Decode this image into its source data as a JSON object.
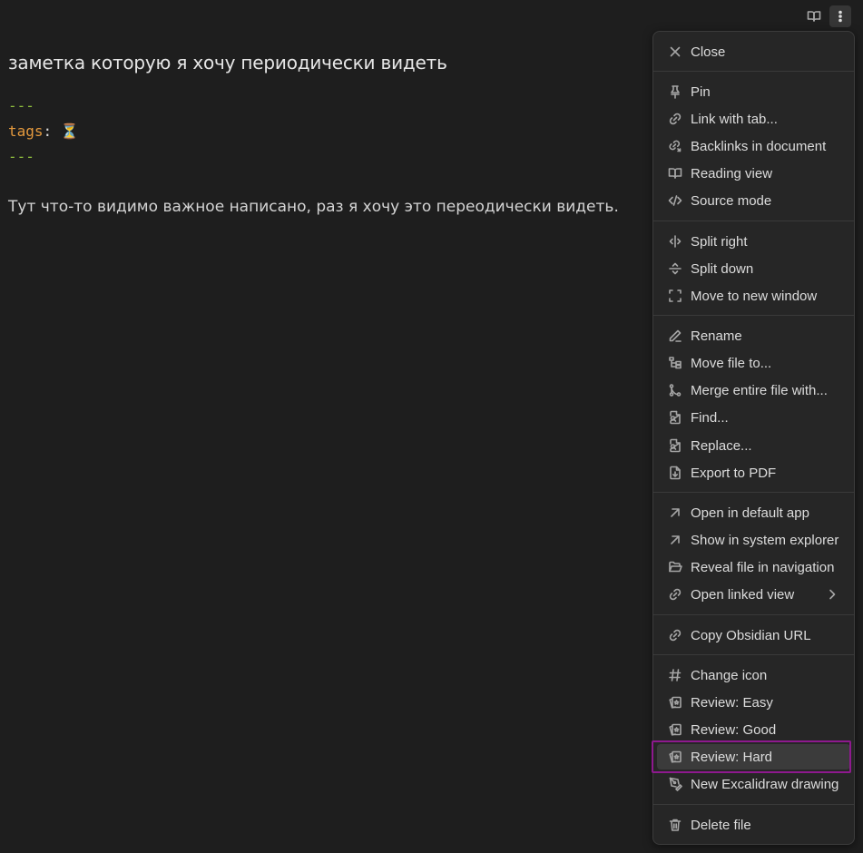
{
  "note": {
    "title": "заметка которую я хочу периодически видеть",
    "frontmatter_dash": "---",
    "tag_key": "tags",
    "tag_colon": ":",
    "tag_value": "⏳",
    "body": "Тут что-то видимо важное написано, раз я хочу это переодически видеть."
  },
  "menu": {
    "close": "Close",
    "pin": "Pin",
    "link_with_tab": "Link with tab...",
    "backlinks": "Backlinks in document",
    "reading_view": "Reading view",
    "source_mode": "Source mode",
    "split_right": "Split right",
    "split_down": "Split down",
    "move_new_window": "Move to new window",
    "rename": "Rename",
    "move_file": "Move file to...",
    "merge_file": "Merge entire file with...",
    "find": "Find...",
    "replace": "Replace...",
    "export_pdf": "Export to PDF",
    "open_default": "Open in default app",
    "show_explorer": "Show in system explorer",
    "reveal_nav": "Reveal file in navigation",
    "open_linked": "Open linked view",
    "copy_url": "Copy Obsidian URL",
    "change_icon": "Change icon",
    "review_easy": "Review: Easy",
    "review_good": "Review: Good",
    "review_hard": "Review: Hard",
    "new_excalidraw": "New Excalidraw drawing",
    "delete_file": "Delete file"
  },
  "colors": {
    "background": "#1e1e1e",
    "menu_background": "#262626",
    "frontmatter_dash": "#8fbf3e",
    "frontmatter_key": "#e59a3e",
    "highlight_border": "#8e198e"
  }
}
